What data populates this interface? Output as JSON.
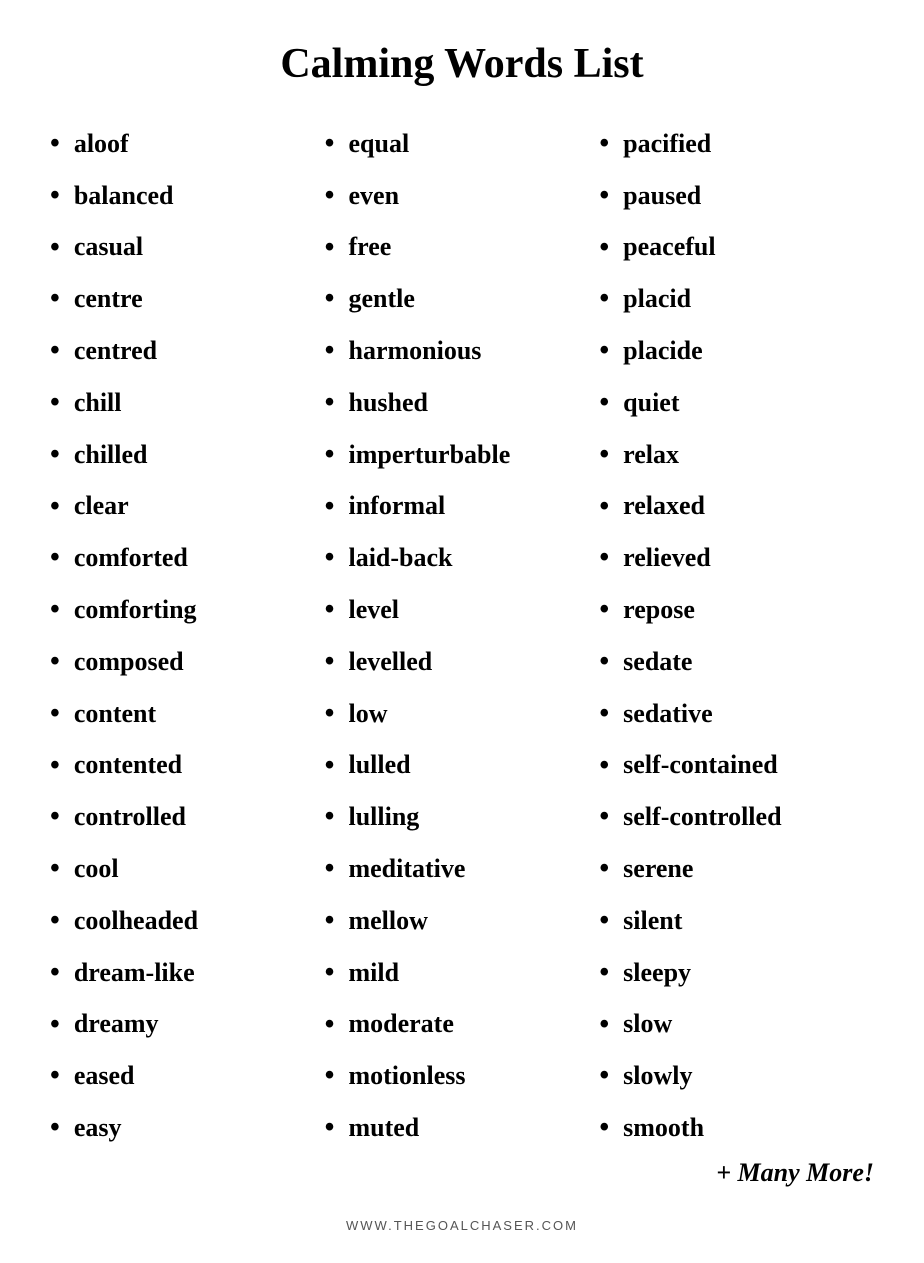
{
  "title": "Calming Words List",
  "columns": [
    {
      "id": "col1",
      "items": [
        "aloof",
        "balanced",
        "casual",
        "centre",
        "centred",
        "chill",
        "chilled",
        "clear",
        "comforted",
        "comforting",
        "composed",
        "content",
        "contented",
        "controlled",
        "cool",
        "coolheaded",
        "dream-like",
        "dreamy",
        "eased",
        "easy"
      ]
    },
    {
      "id": "col2",
      "items": [
        "equal",
        "even",
        "free",
        "gentle",
        "harmonious",
        "hushed",
        "imperturbable",
        "informal",
        "laid-back",
        "level",
        "levelled",
        "low",
        "lulled",
        "lulling",
        "meditative",
        "mellow",
        "mild",
        "moderate",
        "motionless",
        "muted"
      ]
    },
    {
      "id": "col3",
      "items": [
        "pacified",
        "paused",
        "peaceful",
        "placid",
        "placide",
        "quiet",
        "relax",
        "relaxed",
        "relieved",
        "repose",
        "sedate",
        "sedative",
        "self-contained",
        "self-controlled",
        "serene",
        "silent",
        "sleepy",
        "slow",
        "slowly",
        "smooth"
      ]
    }
  ],
  "more_text": "+ Many More!",
  "footer": "WWW.THEGOALCHASER.COM"
}
